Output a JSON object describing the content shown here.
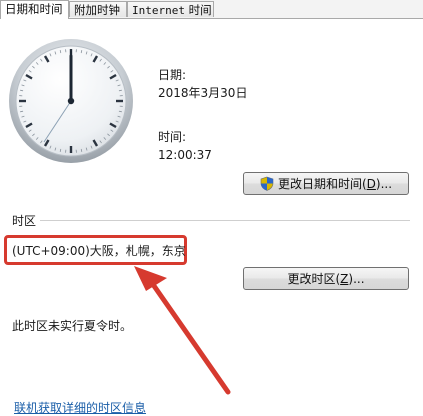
{
  "tabs": {
    "date_time": "日期和时间",
    "additional_clocks": "附加时钟",
    "internet_time_latin": "Internet",
    "internet_time_cjk": " 时间"
  },
  "date": {
    "label": "日期:",
    "value": "2018年3月30日"
  },
  "time": {
    "label": "时间:",
    "value": "12:00:37"
  },
  "buttons": {
    "change_datetime_pre": "更改日期和时间(",
    "change_datetime_key": "D",
    "change_datetime_post": ")...",
    "change_timezone_pre": "更改时区(",
    "change_timezone_key": "Z",
    "change_timezone_post": ")..."
  },
  "timezone": {
    "section_label": "时区",
    "value": "(UTC+09:00)大阪，札幌，东京",
    "dst_note": "此时区未实行夏令时。",
    "link": "联机获取详细的时区信息"
  },
  "colors": {
    "annotation": "#d63a2f",
    "link": "#1a5ea8"
  },
  "icons": {
    "uac_shield": "shield-icon"
  }
}
